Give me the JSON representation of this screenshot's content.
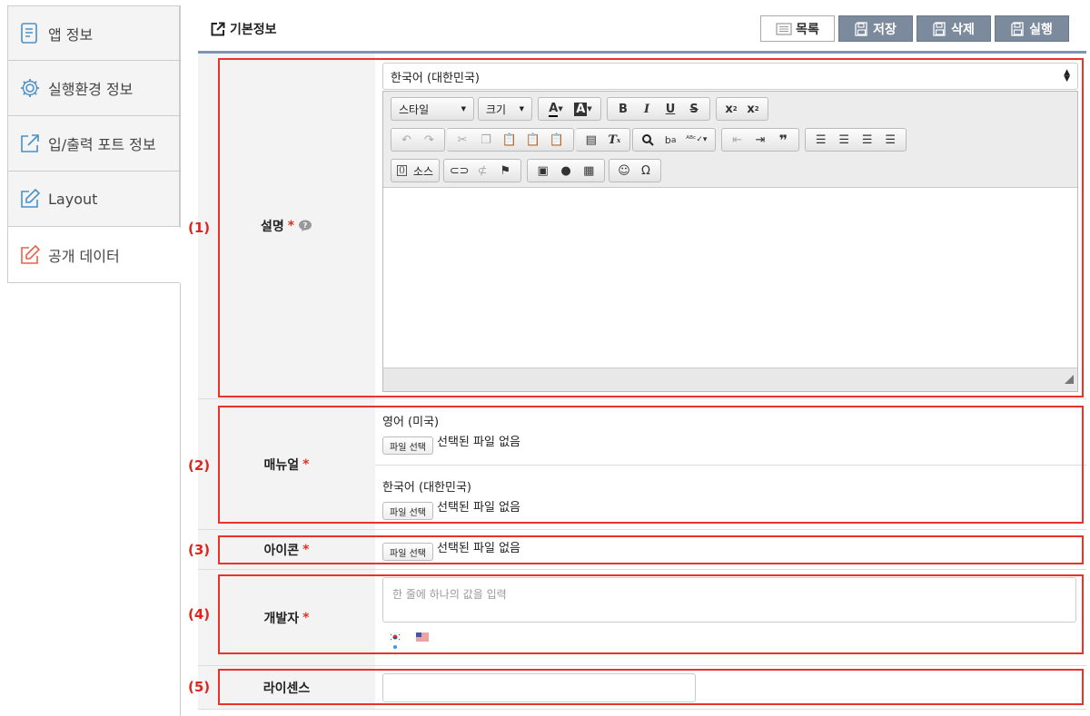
{
  "sidebar": {
    "items": [
      {
        "label": "앱 정보"
      },
      {
        "label": "실행환경 정보"
      },
      {
        "label": "입/출력 포트 정보"
      },
      {
        "label": "Layout"
      },
      {
        "label": "공개 데이터"
      }
    ]
  },
  "header": {
    "title": "기본정보",
    "buttons": {
      "list": "목록",
      "save": "저장",
      "delete": "삭제",
      "run": "실행"
    }
  },
  "markers": [
    "(1)",
    "(2)",
    "(3)",
    "(4)",
    "(5)"
  ],
  "form": {
    "required_mark": "*",
    "description": {
      "label": "설명",
      "language": "한국어 (대한민국)",
      "toolbar": {
        "style": "스타일",
        "size": "크기",
        "source": "소스"
      }
    },
    "manual": {
      "label": "매뉴얼",
      "entries": [
        {
          "language": "영어 (미국)",
          "button": "파일 선택",
          "status": "선택된 파일 없음"
        },
        {
          "language": "한국어 (대한민국)",
          "button": "파일 선택",
          "status": "선택된 파일 없음"
        }
      ]
    },
    "icon": {
      "label": "아이콘",
      "button": "파일 선택",
      "status": "선택된 파일 없음"
    },
    "developer": {
      "label": "개발자",
      "placeholder": "한 줄에 하나의 값을 입력"
    },
    "license": {
      "label": "라이센스",
      "value": ""
    }
  },
  "colors": {
    "accent_red": "#e8322a",
    "button_dark": "#7b8a9c",
    "header_line": "#7d95b4"
  }
}
